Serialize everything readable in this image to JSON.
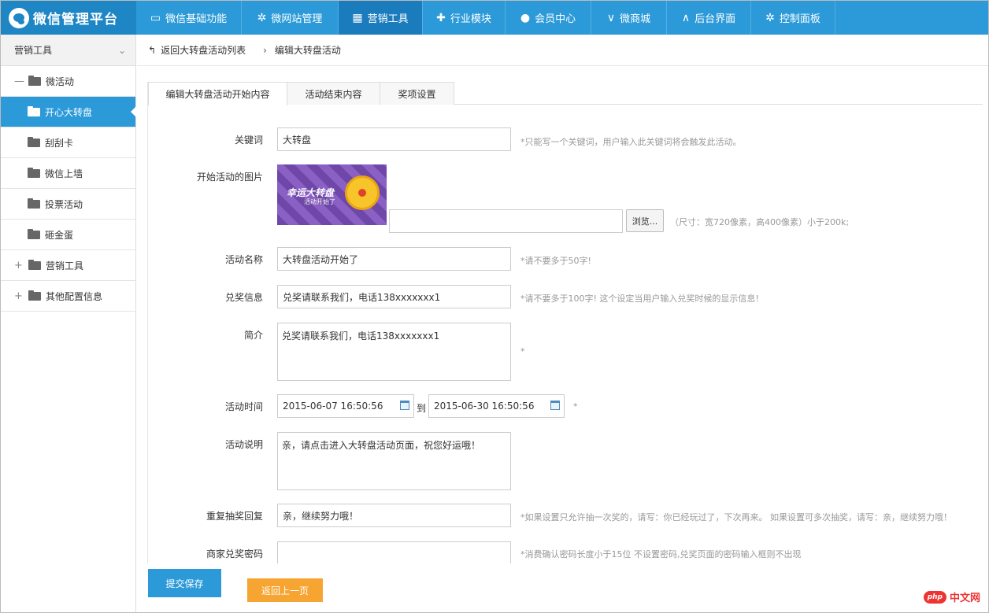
{
  "app": {
    "title": "微信管理平台"
  },
  "nav": [
    {
      "label": "微信基础功能",
      "icon": "monitor-icon"
    },
    {
      "label": "微网站管理",
      "icon": "gear-icon"
    },
    {
      "label": "营销工具",
      "icon": "gift-icon",
      "active": true
    },
    {
      "label": "行业模块",
      "icon": "puzzle-icon"
    },
    {
      "label": "会员中心",
      "icon": "user-icon"
    },
    {
      "label": "微商城",
      "icon": "chevron-down-icon"
    },
    {
      "label": "后台界面",
      "icon": "chevron-up-icon"
    },
    {
      "label": "控制面板",
      "icon": "gear-icon"
    }
  ],
  "sidebar": {
    "header": "营销工具",
    "group1": "微活动",
    "items": [
      "开心大转盘",
      "刮刮卡",
      "微信上墙",
      "投票活动",
      "砸金蛋"
    ],
    "group2": "营销工具",
    "group3": "其他配置信息"
  },
  "breadcrumb": {
    "back": "返回大转盘活动列表",
    "current": "编辑大转盘活动"
  },
  "tabs": [
    "编辑大转盘活动开始内容",
    "活动结束内容",
    "奖项设置"
  ],
  "form": {
    "keyword": {
      "label": "关键词",
      "value": "大转盘",
      "hint": "*只能写一个关键词，用户输入此关键词将会触发此活动。"
    },
    "image": {
      "label": "开始活动的图片",
      "banner_title": "幸运大转盘",
      "banner_sub": "活动开始了",
      "browse": "浏览...",
      "hint": "（尺寸：宽720像素，高400像素）小于200k;"
    },
    "name": {
      "label": "活动名称",
      "value": "大转盘活动开始了",
      "hint": "*请不要多于50字!"
    },
    "prize_info": {
      "label": "兑奖信息",
      "value": "兑奖请联系我们，电话138xxxxxxx1",
      "hint": "*请不要多于100字! 这个设定当用户输入兑奖时候的显示信息!"
    },
    "intro": {
      "label": "简介",
      "value": "兑奖请联系我们，电话138xxxxxxx1",
      "hint": "*"
    },
    "time": {
      "label": "活动时间",
      "start": "2015-06-07 16:50:56",
      "to": "到",
      "end": "2015-06-30 16:50:56",
      "hint": "*"
    },
    "desc": {
      "label": "活动说明",
      "value": "亲，请点击进入大转盘活动页面，祝您好运哦！"
    },
    "repeat": {
      "label": "重复抽奖回复",
      "value": "亲，继续努力哦！",
      "hint": "*如果设置只允许抽一次奖的，请写：你已经玩过了，下次再来。 如果设置可多次抽奖，请写：亲，继续努力哦！"
    },
    "password": {
      "label": "商家兑奖密码",
      "value": "",
      "hint": "*消费确认密码长度小于15位 不设置密码,兑奖页面的密码输入框则不出现"
    }
  },
  "buttons": {
    "submit": "提交保存",
    "back": "返回上一页"
  },
  "watermark": {
    "badge": "php",
    "text": "中文网"
  }
}
